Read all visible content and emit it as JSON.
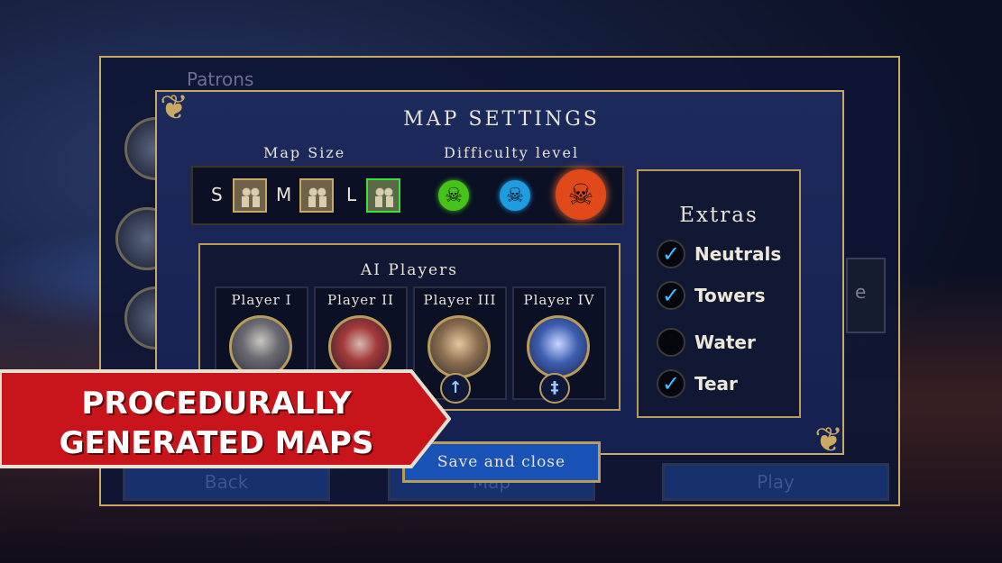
{
  "background": {
    "patrons_label": "Patrons",
    "side_button_fragment": "e",
    "bottom_buttons": [
      "Back",
      "Map",
      "Play"
    ]
  },
  "modal": {
    "title": "MAP SETTINGS",
    "map_size": {
      "label": "Map Size",
      "options": [
        "S",
        "M",
        "L"
      ],
      "selected": "L"
    },
    "difficulty": {
      "label": "Difficulty level",
      "levels": [
        {
          "name": "easy-skull",
          "color": "#47c21a"
        },
        {
          "name": "normal-skull",
          "color": "#1f9be0"
        },
        {
          "name": "hard-skull",
          "color": "#e2491a"
        }
      ],
      "selected": "hard-skull"
    },
    "ai_players": {
      "title": "AI Players",
      "players": [
        {
          "name": "Player I",
          "badge": ""
        },
        {
          "name": "Player II",
          "badge": ""
        },
        {
          "name": "Player III",
          "badge": "↑"
        },
        {
          "name": "Player IV",
          "badge": "‡"
        }
      ]
    },
    "extras": {
      "title": "Extras",
      "items": [
        {
          "label": "Neutrals",
          "checked": true,
          "mark": "✓"
        },
        {
          "label": "Towers",
          "checked": true,
          "mark": "✓"
        },
        {
          "label": "Water",
          "checked": false,
          "mark": ""
        },
        {
          "label": "Tear",
          "checked": true,
          "mark": "✓"
        }
      ]
    },
    "save_button": "Save and close"
  },
  "banner": {
    "line1": "PROCEDURALLY",
    "line2": "GENERATED MAPS",
    "color": "#c8141b"
  }
}
